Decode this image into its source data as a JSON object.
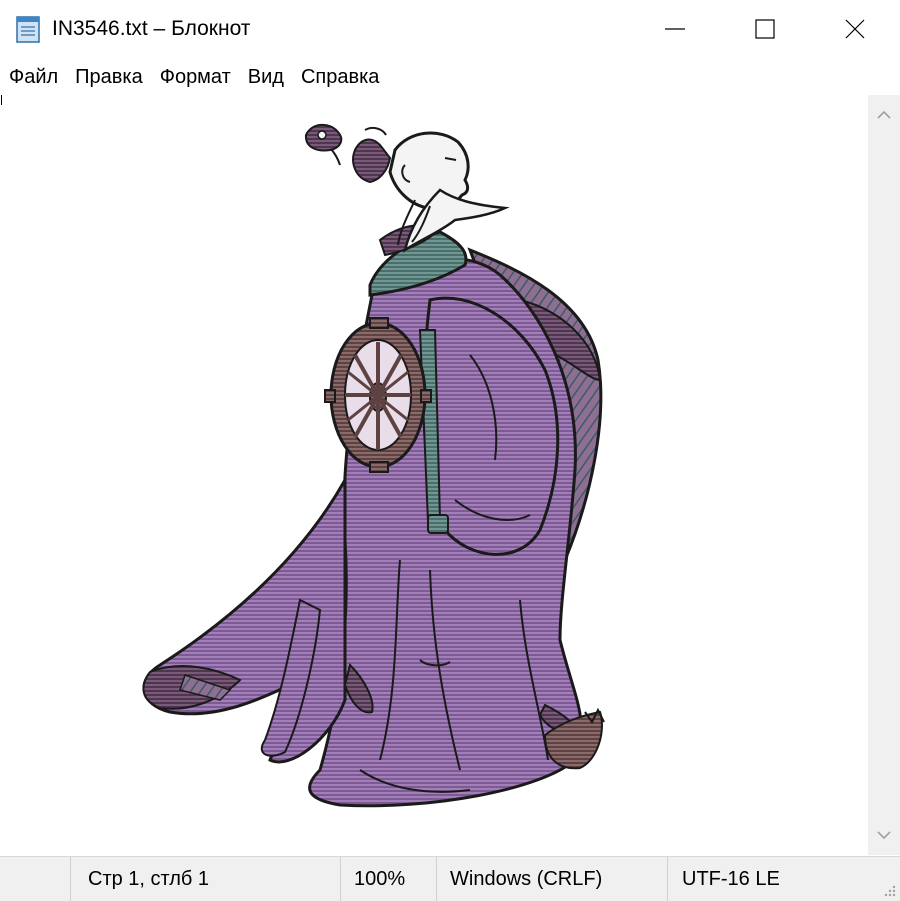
{
  "window": {
    "title": "IN3546.txt – Блокнот"
  },
  "menu": {
    "items": [
      {
        "label": "Файл"
      },
      {
        "label": "Правка"
      },
      {
        "label": "Формат"
      },
      {
        "label": "Вид"
      },
      {
        "label": "Справка"
      }
    ]
  },
  "statusbar": {
    "position": "Стр 1, стлб 1",
    "zoom": "100%",
    "line_endings": "Windows (CRLF)",
    "encoding": "UTF-16 LE"
  },
  "icons": {
    "app": "notepad-icon",
    "minimize": "minimize-icon",
    "maximize": "maximize-icon",
    "close": "close-icon",
    "scroll_up": "chevron-up-icon",
    "scroll_down": "chevron-down-icon",
    "grip": "resize-grip-icon"
  },
  "colors": {
    "robe": "#9a74b0",
    "robe_dark": "#6e4d86",
    "wheel": "#7a5a5a",
    "collar": "#5f8a86",
    "skin": "#f4f4f4",
    "outline": "#1a1a1a"
  }
}
